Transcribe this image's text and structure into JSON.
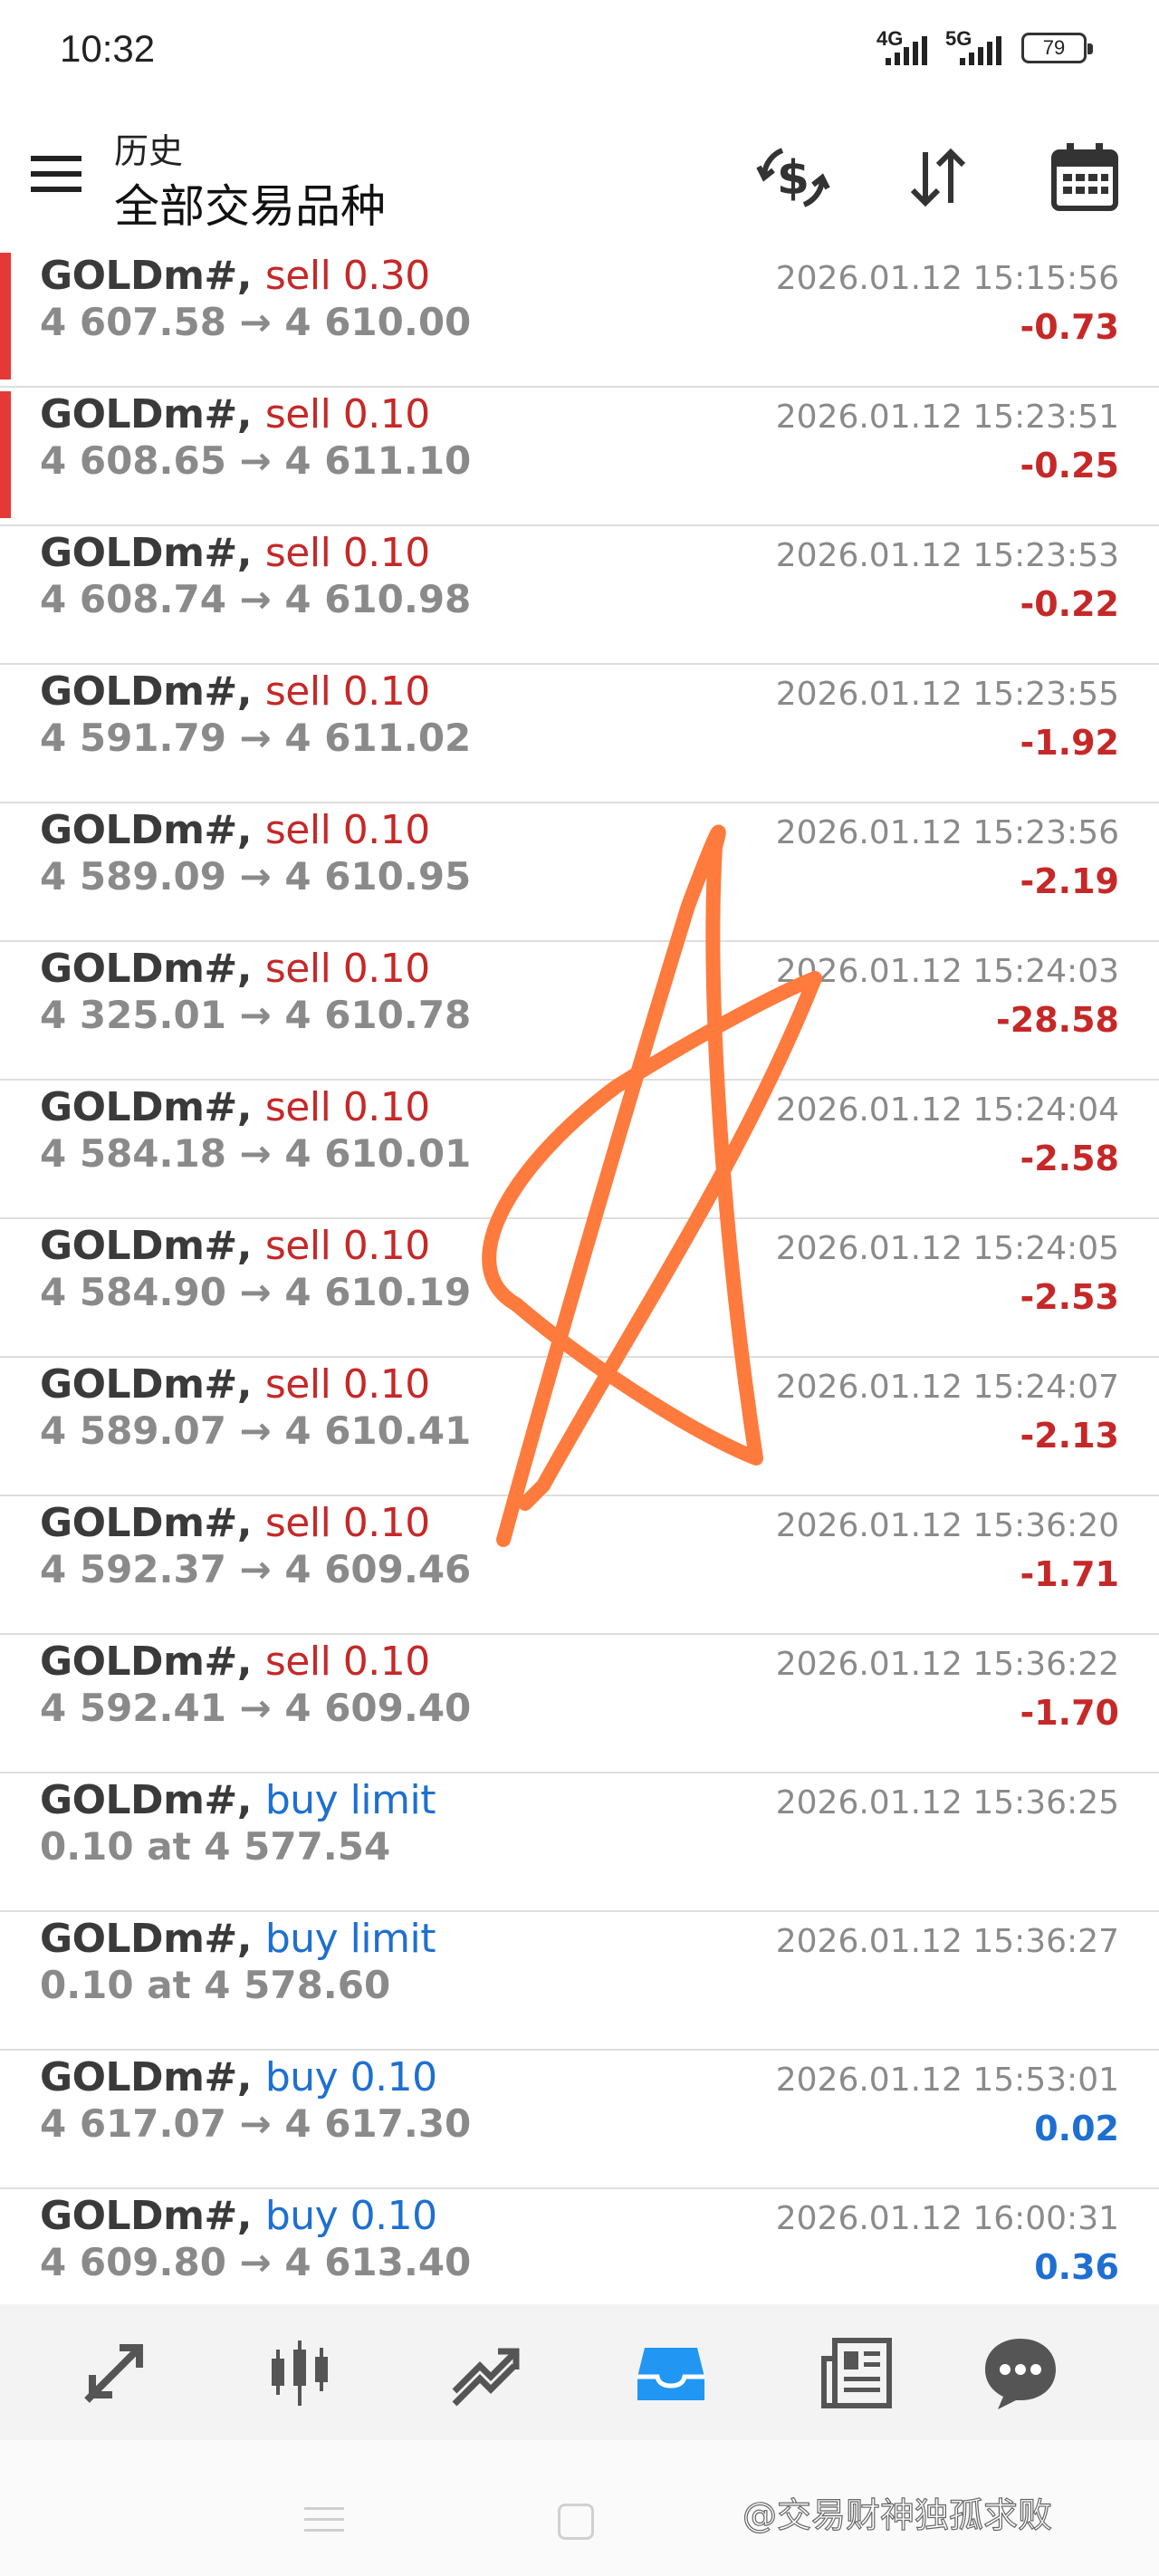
{
  "status_bar": {
    "time": "10:32",
    "net1": "4G",
    "net2": "5G",
    "battery": "79"
  },
  "header": {
    "subtitle": "历史",
    "title": "全部交易品种",
    "icons": [
      "menu-icon",
      "currency-exchange-icon",
      "sort-icon",
      "calendar-icon"
    ]
  },
  "trades": [
    {
      "symbol": "GOLDm#,",
      "action": "sell 0.30",
      "side": "sell",
      "prices": "4 607.58 → 4 610.00",
      "time": "2026.01.12 15:15:56",
      "profit": "-0.73",
      "marked": true
    },
    {
      "symbol": "GOLDm#,",
      "action": "sell 0.10",
      "side": "sell",
      "prices": "4 608.65 → 4 611.10",
      "time": "2026.01.12 15:23:51",
      "profit": "-0.25",
      "marked": true
    },
    {
      "symbol": "GOLDm#,",
      "action": "sell 0.10",
      "side": "sell",
      "prices": "4 608.74 → 4 610.98",
      "time": "2026.01.12 15:23:53",
      "profit": "-0.22",
      "marked": false
    },
    {
      "symbol": "GOLDm#,",
      "action": "sell 0.10",
      "side": "sell",
      "prices": "4 591.79 → 4 611.02",
      "time": "2026.01.12 15:23:55",
      "profit": "-1.92",
      "marked": false
    },
    {
      "symbol": "GOLDm#,",
      "action": "sell 0.10",
      "side": "sell",
      "prices": "4 589.09 → 4 610.95",
      "time": "2026.01.12 15:23:56",
      "profit": "-2.19",
      "marked": false
    },
    {
      "symbol": "GOLDm#,",
      "action": "sell 0.10",
      "side": "sell",
      "prices": "4 325.01 → 4 610.78",
      "time": "2026.01.12 15:24:03",
      "profit": "-28.58",
      "marked": false
    },
    {
      "symbol": "GOLDm#,",
      "action": "sell 0.10",
      "side": "sell",
      "prices": "4 584.18 → 4 610.01",
      "time": "2026.01.12 15:24:04",
      "profit": "-2.58",
      "marked": false
    },
    {
      "symbol": "GOLDm#,",
      "action": "sell 0.10",
      "side": "sell",
      "prices": "4 584.90 → 4 610.19",
      "time": "2026.01.12 15:24:05",
      "profit": "-2.53",
      "marked": false
    },
    {
      "symbol": "GOLDm#,",
      "action": "sell 0.10",
      "side": "sell",
      "prices": "4 589.07 → 4 610.41",
      "time": "2026.01.12 15:24:07",
      "profit": "-2.13",
      "marked": false
    },
    {
      "symbol": "GOLDm#,",
      "action": "sell 0.10",
      "side": "sell",
      "prices": "4 592.37 → 4 609.46",
      "time": "2026.01.12 15:36:20",
      "profit": "-1.71",
      "marked": false
    },
    {
      "symbol": "GOLDm#,",
      "action": "sell 0.10",
      "side": "sell",
      "prices": "4 592.41 → 4 609.40",
      "time": "2026.01.12 15:36:22",
      "profit": "-1.70",
      "marked": false
    },
    {
      "symbol": "GOLDm#,",
      "action": "buy limit",
      "side": "buy",
      "prices": "0.10 at 4 577.54",
      "time": "2026.01.12 15:36:25",
      "profit": "",
      "marked": false
    },
    {
      "symbol": "GOLDm#,",
      "action": "buy limit",
      "side": "buy",
      "prices": "0.10 at 4 578.60",
      "time": "2026.01.12 15:36:27",
      "profit": "",
      "marked": false
    },
    {
      "symbol": "GOLDm#,",
      "action": "buy 0.10",
      "side": "buy",
      "prices": "4 617.07 → 4 617.30",
      "time": "2026.01.12 15:53:01",
      "profit": "0.02",
      "marked": false
    },
    {
      "symbol": "GOLDm#,",
      "action": "buy 0.10",
      "side": "buy",
      "prices": "4 609.80 → 4 613.40",
      "time": "2026.01.12 16:00:31",
      "profit": "0.36",
      "marked": false
    }
  ],
  "bottom_nav": {
    "items": [
      "quotes-icon",
      "chart-icon",
      "trade-icon",
      "history-icon",
      "news-icon",
      "chat-icon"
    ],
    "active": "history-icon"
  },
  "watermark": "@交易财神独孤求败",
  "colors": {
    "sell": "#c62828",
    "buy": "#1e6fd1",
    "marker": "#e53935",
    "active_nav": "#2196f3",
    "scribble": "#ff7a3d"
  }
}
